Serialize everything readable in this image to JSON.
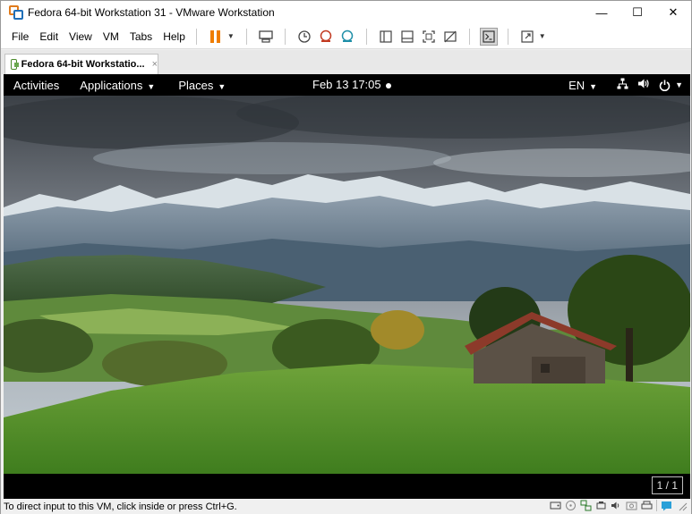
{
  "window": {
    "title": "Fedora 64-bit Workstation 31 - VMware Workstation",
    "controls": {
      "minimize": "—",
      "maximize": "☐",
      "close": "✕"
    }
  },
  "menu": {
    "items": [
      "File",
      "Edit",
      "View",
      "VM",
      "Tabs",
      "Help"
    ]
  },
  "toolbar": {
    "icons": [
      "pause-icon",
      "send-ctrl-alt-del-icon",
      "snapshot-take-icon",
      "snapshot-revert-icon",
      "snapshot-manager-icon",
      "view-library-icon",
      "view-thumbnail-icon",
      "fullscreen-icon",
      "unity-icon",
      "console-icon",
      "stretch-icon"
    ],
    "accent_pause": "#ef7d00"
  },
  "tab": {
    "label": "Fedora 64-bit Workstatio...",
    "close": "×"
  },
  "gnome": {
    "activities": "Activities",
    "applications": "Applications",
    "places": "Places",
    "clock": "Feb 13  17:05",
    "language": "EN",
    "icons": [
      "network-icon",
      "volume-icon",
      "power-icon"
    ]
  },
  "workspace": {
    "indicator": "1 / 1"
  },
  "status": {
    "text": "To direct input to this VM, click inside or press Ctrl+G.",
    "icons": [
      "hdd-icon",
      "cd-icon",
      "network-adapter-icon",
      "usb-icon",
      "sound-icon",
      "camera-icon",
      "printer-icon",
      "message-icon"
    ]
  },
  "colors": {
    "topbar_bg": "#000000",
    "statusbar_bg": "#f0f0f0",
    "toolbar_accent": "#ef7d00"
  }
}
